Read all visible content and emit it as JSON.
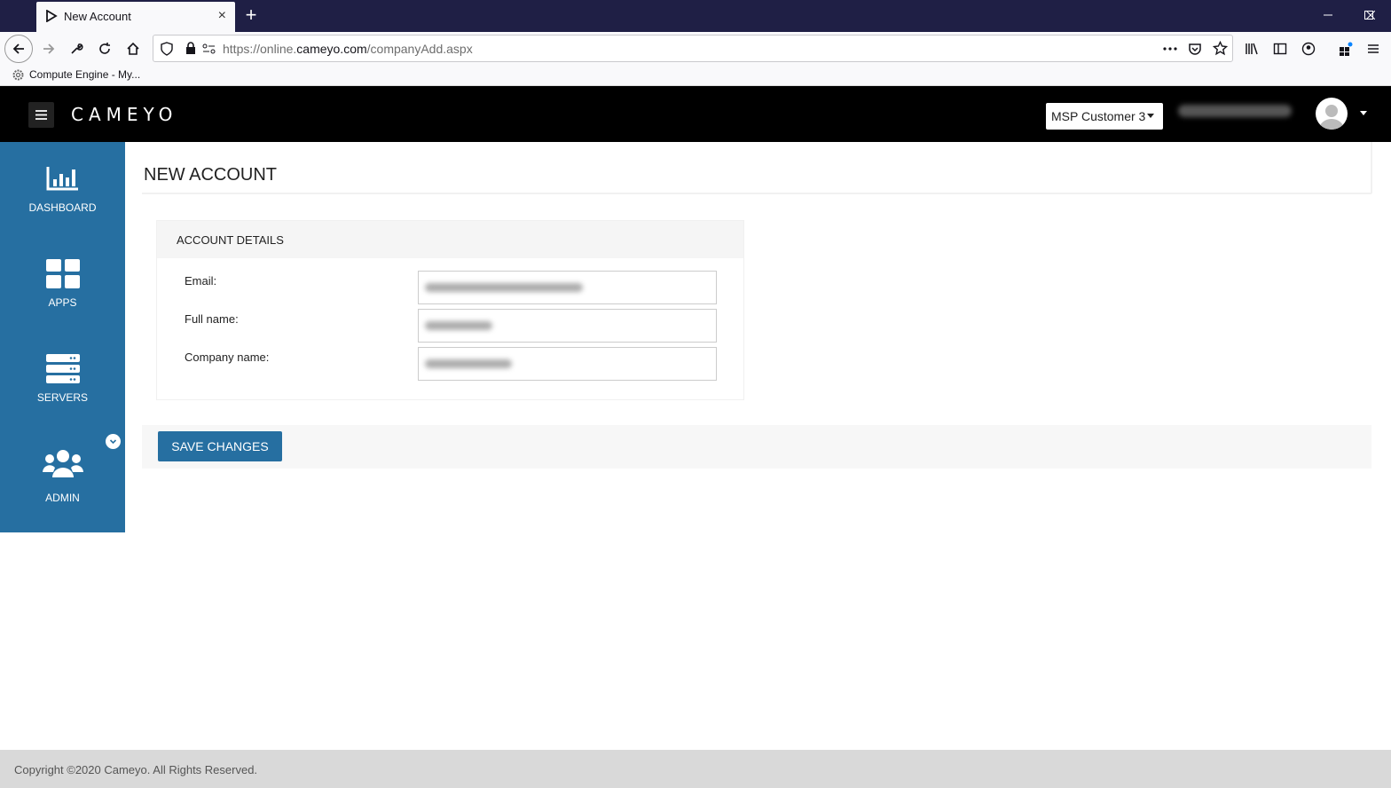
{
  "browser": {
    "tab_title": "New Account",
    "tab_close": "×",
    "new_tab": "+",
    "url_prefix": "https://online.",
    "url_domain": "cameyo.com",
    "url_path": "/companyAdd.aspx",
    "bookmark_label": "Compute Engine - My..."
  },
  "header": {
    "logo": "CAMEYO",
    "customer_select": "MSP Customer 3"
  },
  "sidebar": {
    "items": [
      {
        "label": "DASHBOARD",
        "icon": "chart-icon"
      },
      {
        "label": "APPS",
        "icon": "grid-icon"
      },
      {
        "label": "SERVERS",
        "icon": "server-icon"
      },
      {
        "label": "ADMIN",
        "icon": "users-icon"
      }
    ]
  },
  "main": {
    "title": "NEW ACCOUNT",
    "panel_title": "ACCOUNT DETAILS",
    "fields": [
      {
        "label": "Email:"
      },
      {
        "label": "Full name:"
      },
      {
        "label": "Company name:"
      }
    ],
    "save_label": "SAVE CHANGES"
  },
  "footer": {
    "text": "Copyright ©2020 Cameyo. All Rights Reserved."
  },
  "colors": {
    "accent": "#266fa1",
    "header_bg": "#000000",
    "tabstrip_bg": "#1f1f45"
  }
}
